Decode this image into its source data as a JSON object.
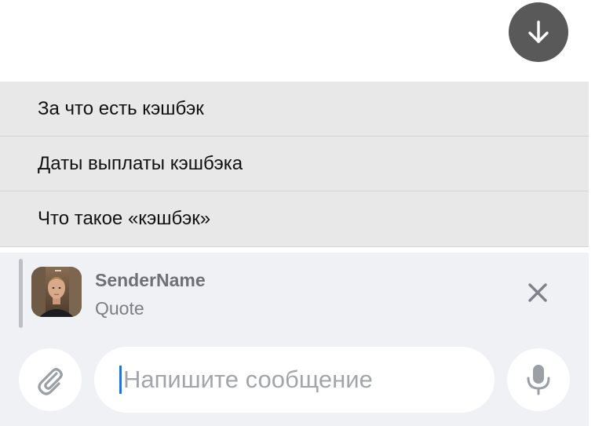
{
  "scroll_button": {
    "icon": "arrow-down-icon"
  },
  "suggestions": [
    {
      "label": "За что есть кэшбэк"
    },
    {
      "label": "Даты выплаты кэшбэка"
    },
    {
      "label": "Что такое «кэшбэк»"
    }
  ],
  "reply": {
    "sender": "SenderName",
    "quote": "Quote",
    "avatar_icon": "user-avatar",
    "close_icon": "close-icon"
  },
  "composer": {
    "attach_icon": "paperclip-icon",
    "value": "",
    "placeholder": "Напишите сообщение",
    "mic_icon": "microphone-icon"
  },
  "colors": {
    "suggestion_bg": "#e8e8e8",
    "panel_bg": "#eff1f5",
    "scroll_button_bg": "#595959",
    "caret": "#1a73e8"
  }
}
